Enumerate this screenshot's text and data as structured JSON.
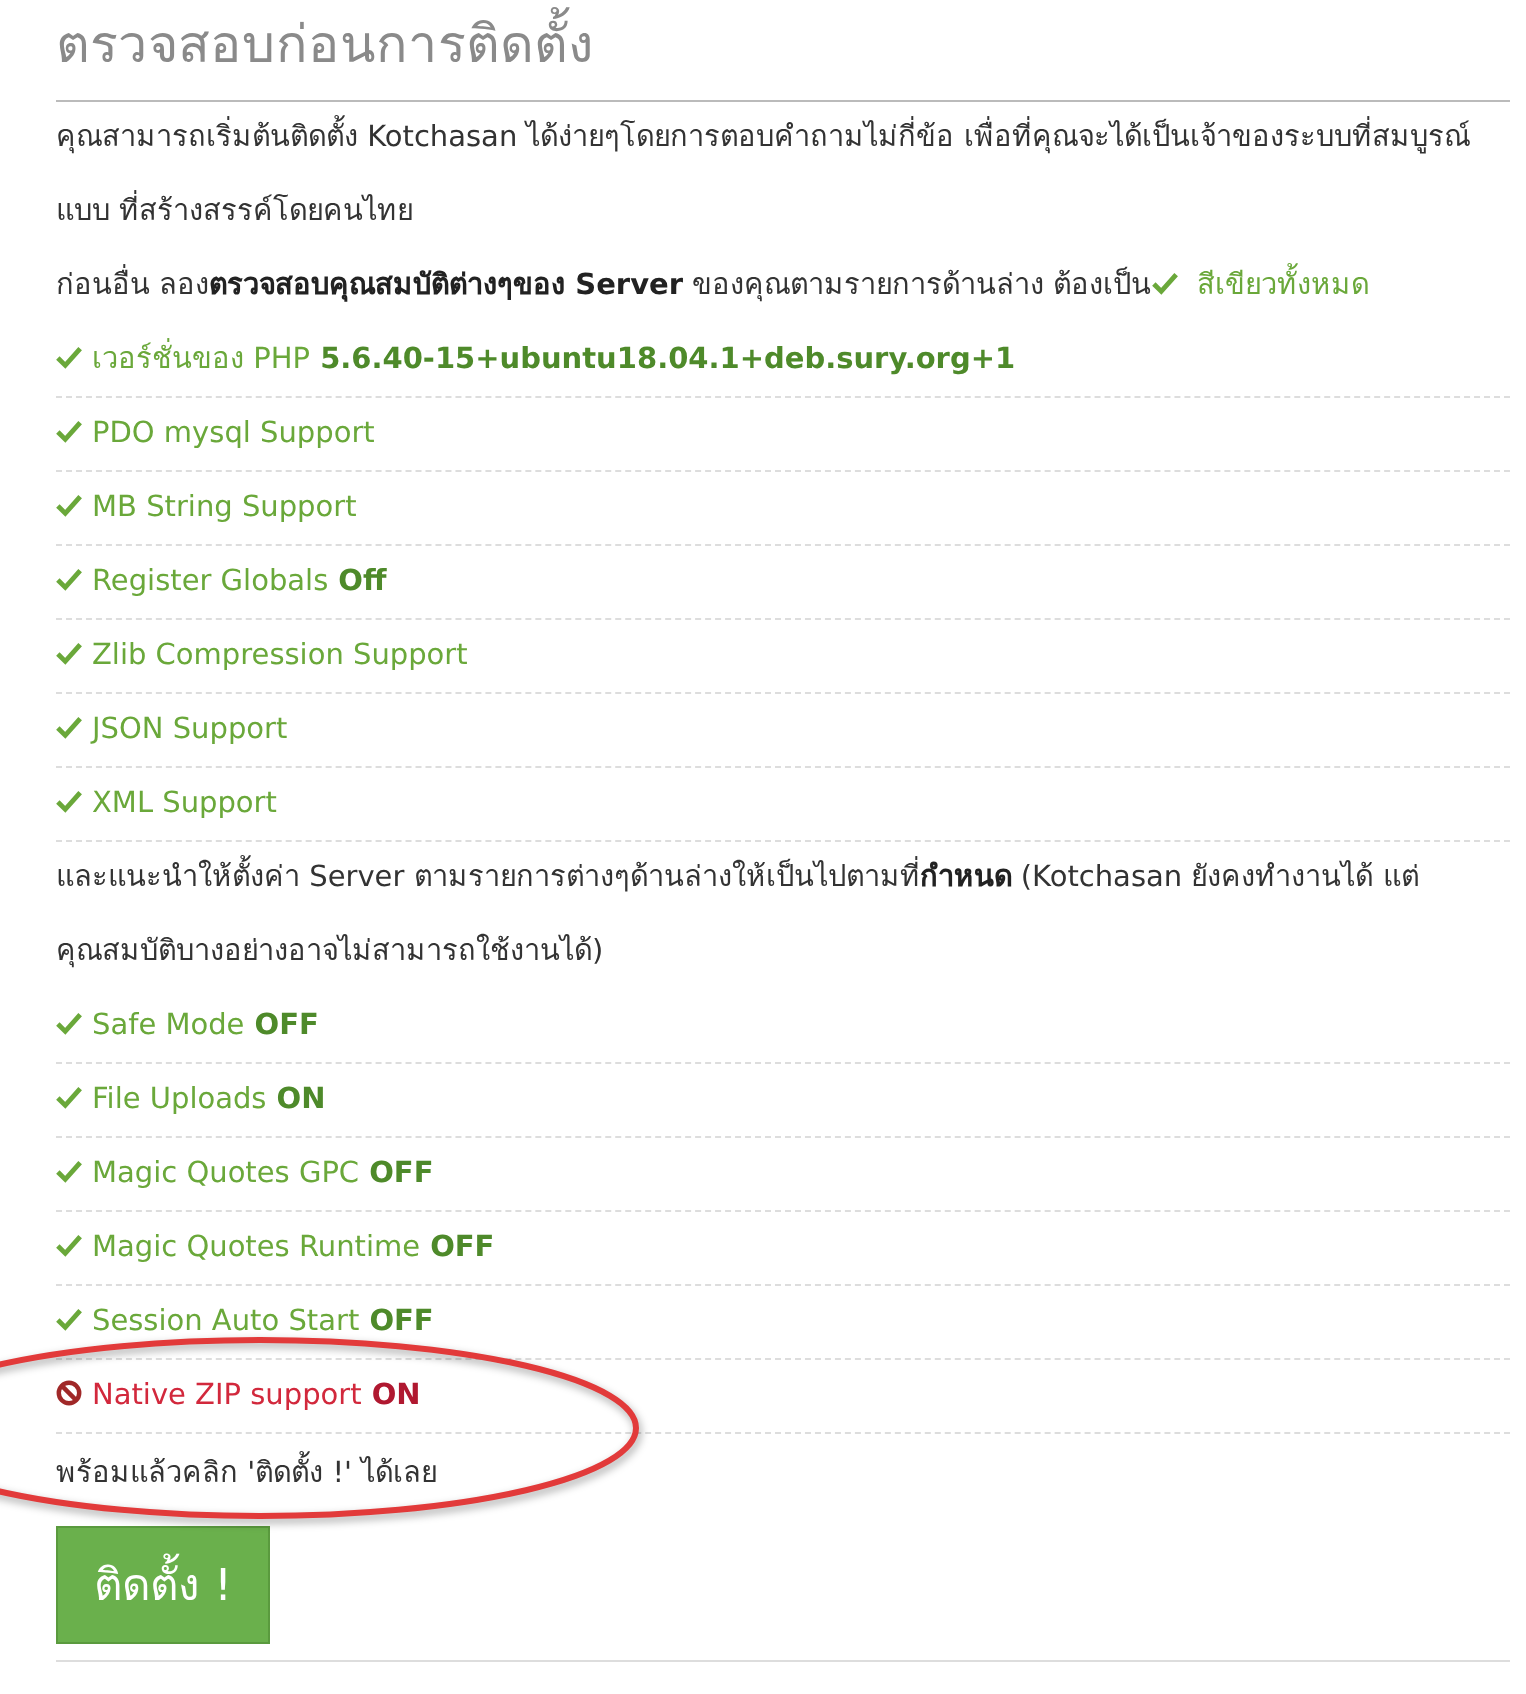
{
  "title": "ตรวจสอบก่อนการติดตั้ง",
  "intro": "คุณสามารถเริ่มต้นติดตั้ง Kotchasan ได้ง่ายๆโดยการตอบคำถามไม่กี่ข้อ เพื่อที่คุณจะได้เป็นเจ้าของระบบที่สมบูรณ์แบบ ที่สร้างสรรค์โดยคนไทย",
  "requirement_note": {
    "text": "ก่อนอื่น ลอง**ตรวจสอบคุณสมบัติต่างๆของ Server** ของคุณตามรายการด้านล่าง ต้องเป็น",
    "highlight": "สีเขียวทั้งหมด"
  },
  "requirements": [
    {
      "label": "เวอร์ชั่นของ PHP",
      "value": "5.6.40-15+ubuntu18.04.1+deb.sury.org+1",
      "ok": true
    },
    {
      "label": "PDO mysql Support",
      "ok": true
    },
    {
      "label": "MB String Support",
      "ok": true
    },
    {
      "label": "Register Globals",
      "value": "Off",
      "ok": true
    },
    {
      "label": "Zlib Compression Support",
      "ok": true
    },
    {
      "label": "JSON Support",
      "ok": true
    },
    {
      "label": "XML Support",
      "ok": true
    }
  ],
  "recommendation_note": "และแนะนำให้ตั้งค่า Server ตามรายการต่างๆด้านล่างให้เป็นไปตามที่**กำหนด** (Kotchasan ยังคงทำงานได้ แต่คุณสมบัติบางอย่างอาจไม่สามารถใช้งานได้)",
  "recommendations": [
    {
      "label": "Safe Mode",
      "value": "OFF",
      "ok": true
    },
    {
      "label": "File Uploads",
      "value": "ON",
      "ok": true
    },
    {
      "label": "Magic Quotes GPC",
      "value": "OFF",
      "ok": true
    },
    {
      "label": "Magic Quotes Runtime",
      "value": "OFF",
      "ok": true
    },
    {
      "label": "Session Auto Start",
      "value": "OFF",
      "ok": true
    },
    {
      "label": "Native ZIP support",
      "value": "ON",
      "ok": false
    }
  ],
  "ready_text": "พร้อมแล้วคลิก 'ติดตั้ง !' ได้เลย",
  "install_button": "ติดตั้ง !",
  "annotation": {
    "kind": "ellipse"
  }
}
